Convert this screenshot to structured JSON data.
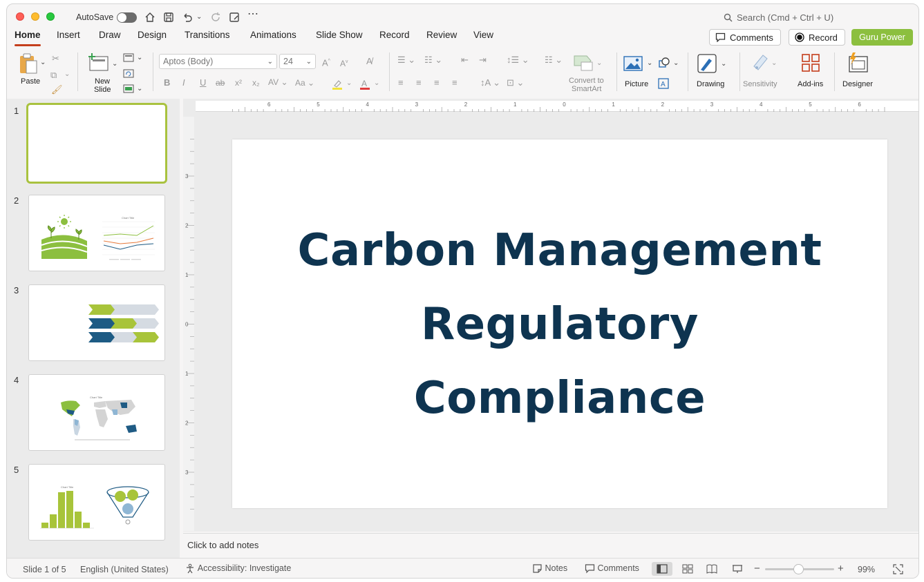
{
  "titlebar": {
    "autosave_label": "AutoSave",
    "search_placeholder": "Search (Cmd + Ctrl + U)"
  },
  "tabs": [
    "Home",
    "Insert",
    "Draw",
    "Design",
    "Transitions",
    "Animations",
    "Slide Show",
    "Record",
    "Review",
    "View"
  ],
  "header_buttons": {
    "comments": "Comments",
    "record": "Record",
    "guru": "Guru Power"
  },
  "ribbon": {
    "paste": "Paste",
    "new_slide_1": "New",
    "new_slide_2": "Slide",
    "font_name": "Aptos (Body)",
    "font_size": "24",
    "convert_1": "Convert to",
    "convert_2": "SmartArt",
    "picture": "Picture",
    "drawing": "Drawing",
    "sensitivity": "Sensitivity",
    "addins": "Add-ins",
    "designer": "Designer"
  },
  "ruler": {
    "h_labels": [
      "6",
      "5",
      "4",
      "3",
      "2",
      "1",
      "0",
      "1",
      "2",
      "3",
      "4",
      "5",
      "6"
    ],
    "v_labels": [
      "3",
      "2",
      "1",
      "0",
      "1",
      "2",
      "3"
    ]
  },
  "thumbnails": {
    "numbers": [
      "1",
      "2",
      "3",
      "4",
      "5"
    ],
    "chart_title": "Chart Title"
  },
  "slide": {
    "title_lines": [
      "Carbon Management",
      "Regulatory",
      "Compliance"
    ]
  },
  "notes_placeholder": "Click to add notes",
  "status": {
    "slide_info": "Slide 1 of 5",
    "language": "English (United States)",
    "accessibility": "Accessibility: Investigate",
    "notes": "Notes",
    "comments": "Comments",
    "zoom": "99%"
  },
  "colors": {
    "accent_red": "#c43e1c",
    "brand_green": "#8cbf3f",
    "title_navy": "#0e3450",
    "selected_border": "#a9c23f"
  }
}
